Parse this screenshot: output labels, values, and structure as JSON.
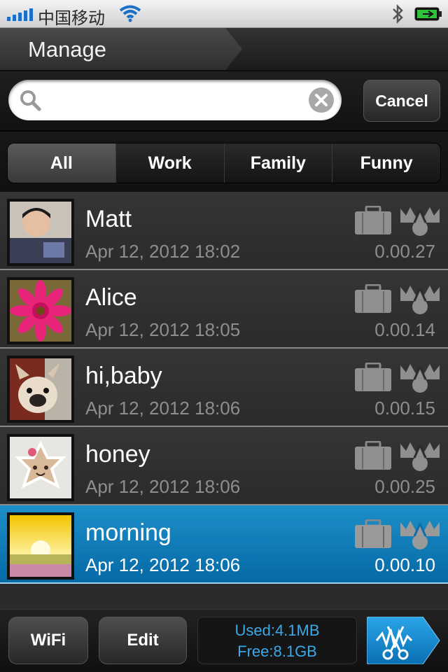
{
  "status_bar": {
    "carrier": "中国移动",
    "icons": [
      "signal-icon",
      "wifi-icon",
      "bluetooth-icon",
      "battery-charging-icon"
    ]
  },
  "header": {
    "title": "Manage"
  },
  "search": {
    "value": "",
    "placeholder": "",
    "cancel_label": "Cancel"
  },
  "tabs": [
    {
      "label": "All",
      "active": true
    },
    {
      "label": "Work",
      "active": false
    },
    {
      "label": "Family",
      "active": false
    },
    {
      "label": "Funny",
      "active": false
    }
  ],
  "recordings": [
    {
      "title": "Matt",
      "date": "Apr 12, 2012 18:02",
      "duration": "0.00.27",
      "selected": false,
      "thumb": "child-photo"
    },
    {
      "title": "Alice",
      "date": "Apr 12, 2012 18:05",
      "duration": "0.00.14",
      "selected": false,
      "thumb": "pink-flower"
    },
    {
      "title": "hi,baby",
      "date": "Apr 12, 2012 18:06",
      "duration": "0.00.15",
      "selected": false,
      "thumb": "dog-photo"
    },
    {
      "title": "honey",
      "date": "Apr 12, 2012 18:06",
      "duration": "0.00.25",
      "selected": false,
      "thumb": "cookie-photo"
    },
    {
      "title": "morning",
      "date": "Apr 12, 2012 18:06",
      "duration": "0.00.10",
      "selected": true,
      "thumb": "sunrise-field"
    }
  ],
  "toolbar": {
    "wifi_label": "WiFi",
    "edit_label": "Edit",
    "storage_used": "Used:4.1MB",
    "storage_free": "Free:8.1GB"
  },
  "colors": {
    "accent": "#0a78b8",
    "storage_text": "#3ba9e8"
  }
}
